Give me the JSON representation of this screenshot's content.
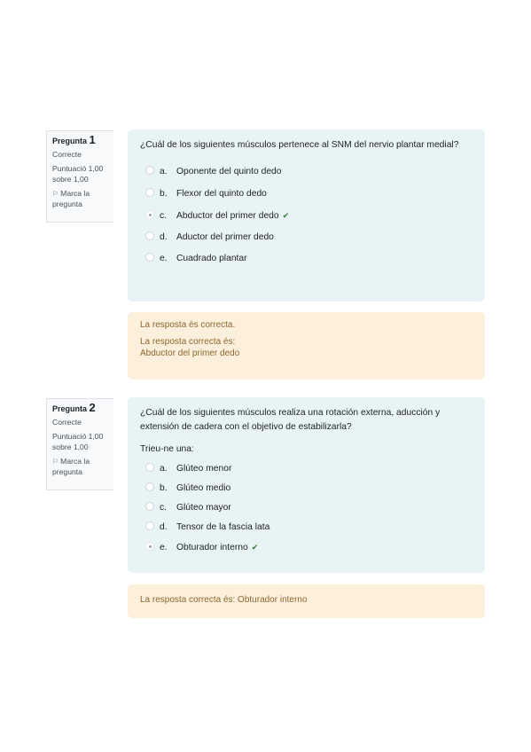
{
  "questions": [
    {
      "label": "Pregunta",
      "number": "1",
      "state": "Correcte",
      "grade": "Puntuació 1,00 sobre 1,00",
      "flag": "Marca la pregunta",
      "text": "¿Cuál de los siguientes músculos pertenece al SNM del nervio plantar medial?",
      "options": [
        {
          "letter": "a.",
          "text": "Oponente del quinto dedo",
          "selected": false,
          "correct": false
        },
        {
          "letter": "b.",
          "text": "Flexor del quinto dedo",
          "selected": false,
          "correct": false
        },
        {
          "letter": "c.",
          "text": "Abductor del primer dedo",
          "selected": true,
          "correct": true
        },
        {
          "letter": "d.",
          "text": "Aductor del primer dedo",
          "selected": false,
          "correct": false
        },
        {
          "letter": "e.",
          "text": "Cuadrado plantar",
          "selected": false,
          "correct": false
        }
      ],
      "feedback_general": "La resposta és correcta.",
      "feedback_right_label": "La resposta correcta és:",
      "feedback_right_answer": "Abductor del primer dedo"
    },
    {
      "label": "Pregunta",
      "number": "2",
      "state": "Correcte",
      "grade": "Puntuació 1,00 sobre 1,00",
      "flag": "Marca la pregunta",
      "text": "¿Cuál de los siguientes músculos realiza una rotación externa, aducción y extensión de cadera con el objetivo de estabilizarla?",
      "prompt": "Trieu-ne una:",
      "options": [
        {
          "letter": "a.",
          "text": "Glúteo menor",
          "selected": false,
          "correct": false
        },
        {
          "letter": "b.",
          "text": "Glúteo medio",
          "selected": false,
          "correct": false
        },
        {
          "letter": "c.",
          "text": "Glúteo mayor",
          "selected": false,
          "correct": false
        },
        {
          "letter": "d.",
          "text": "Tensor de la fascia lata",
          "selected": false,
          "correct": false
        },
        {
          "letter": "e.",
          "text": "Obturador interno",
          "selected": true,
          "correct": true
        }
      ],
      "feedback_right": "La resposta correcta és: Obturador interno"
    }
  ],
  "icons": {
    "flag": "flag-icon",
    "correct": "check-icon"
  },
  "colors": {
    "question_bg": "#e7f3f5",
    "feedback_bg": "#fcefdc",
    "feedback_text": "#8e662e",
    "correct_check": "#357a32"
  }
}
